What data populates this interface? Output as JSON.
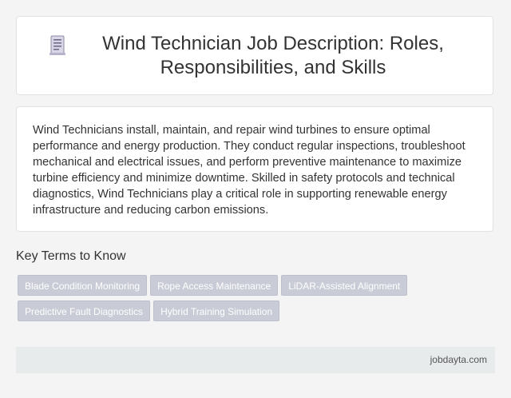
{
  "header": {
    "icon": "document-icon",
    "title": "Wind Technician Job Description: Roles, Responsibilities, and Skills"
  },
  "description": {
    "text": "Wind Technicians install, maintain, and repair wind turbines to ensure optimal performance and energy production. They conduct regular inspections, troubleshoot mechanical and electrical issues, and perform preventive maintenance to maximize turbine efficiency and minimize downtime. Skilled in safety protocols and technical diagnostics, Wind Technicians play a critical role in supporting renewable energy infrastructure and reducing carbon emissions."
  },
  "key_terms": {
    "heading": "Key Terms to Know",
    "tags": [
      "Blade Condition Monitoring",
      "Rope Access Maintenance",
      "LiDAR-Assisted Alignment",
      "Predictive Fault Diagnostics",
      "Hybrid Training Simulation"
    ]
  },
  "footer": {
    "site": "jobdayta.com"
  },
  "colors": {
    "tag_background": "#c9ccd6",
    "footer_background": "#e7ebeb",
    "page_background": "#f4f4f4"
  }
}
